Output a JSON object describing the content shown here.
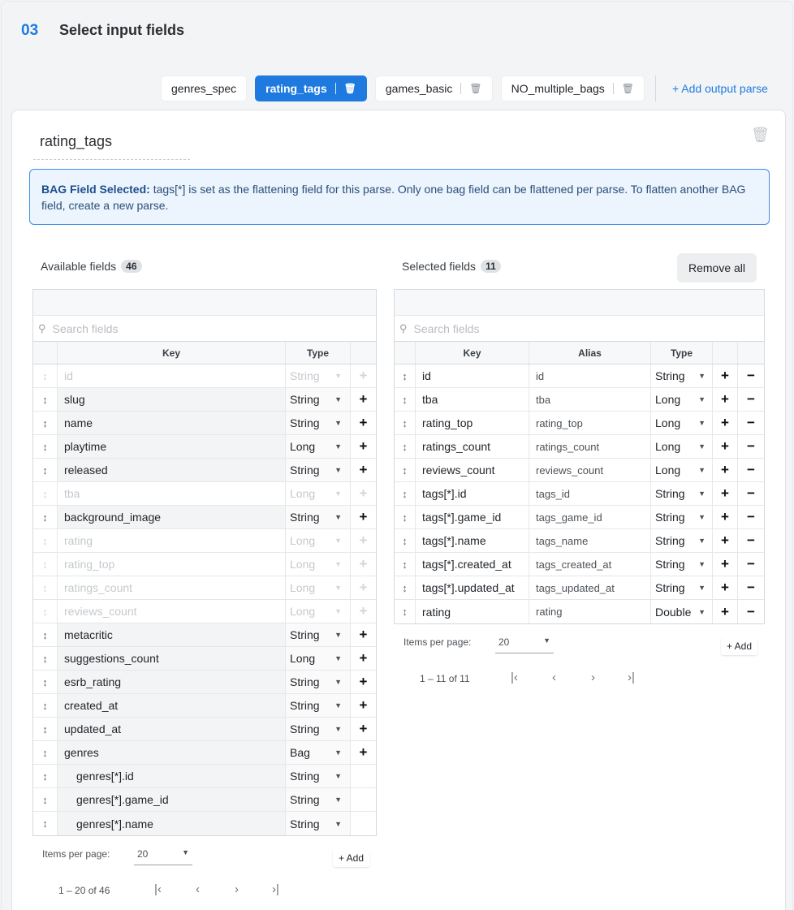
{
  "step": {
    "number": "03",
    "title": "Select input fields"
  },
  "tabs": [
    {
      "label": "genres_spec",
      "active": false,
      "deletable": false
    },
    {
      "label": "rating_tags",
      "active": true,
      "deletable": true
    },
    {
      "label": "games_basic",
      "active": false,
      "deletable": true
    },
    {
      "label": "NO_multiple_bags",
      "active": false,
      "deletable": true
    }
  ],
  "add_output_parse": "+ Add output parse",
  "parse": {
    "name": "rating_tags"
  },
  "banner": {
    "bold": "BAG Field Selected:",
    "text": " tags[*] is set as the flattening field for this parse. Only one bag field can be flattened per parse. To flatten another BAG field, create a new parse."
  },
  "available": {
    "label": "Available fields",
    "count": "46",
    "search_placeholder": "Search fields",
    "headers": {
      "key": "Key",
      "type": "Type"
    },
    "rows": [
      {
        "key": "id",
        "type": "String",
        "disabled": true
      },
      {
        "key": "slug",
        "type": "String"
      },
      {
        "key": "name",
        "type": "String"
      },
      {
        "key": "playtime",
        "type": "Long"
      },
      {
        "key": "released",
        "type": "String"
      },
      {
        "key": "tba",
        "type": "Long",
        "disabled": true
      },
      {
        "key": "background_image",
        "type": "String"
      },
      {
        "key": "rating",
        "type": "Long",
        "disabled": true
      },
      {
        "key": "rating_top",
        "type": "Long",
        "disabled": true
      },
      {
        "key": "ratings_count",
        "type": "Long",
        "disabled": true
      },
      {
        "key": "reviews_count",
        "type": "Long",
        "disabled": true
      },
      {
        "key": "metacritic",
        "type": "String"
      },
      {
        "key": "suggestions_count",
        "type": "Long"
      },
      {
        "key": "esrb_rating",
        "type": "String"
      },
      {
        "key": "created_at",
        "type": "String"
      },
      {
        "key": "updated_at",
        "type": "String"
      },
      {
        "key": "genres",
        "type": "Bag"
      },
      {
        "key": "genres[*].id",
        "type": "String",
        "child": true
      },
      {
        "key": "genres[*].game_id",
        "type": "String",
        "child": true
      },
      {
        "key": "genres[*].name",
        "type": "String",
        "child": true
      }
    ],
    "items_per_page_label": "Items per page:",
    "items_per_page": "20",
    "add_label": "+ Add",
    "range": "1 – 20 of 46"
  },
  "selected": {
    "label": "Selected fields",
    "count": "11",
    "remove_all": "Remove all",
    "search_placeholder": "Search fields",
    "headers": {
      "key": "Key",
      "alias": "Alias",
      "type": "Type"
    },
    "rows": [
      {
        "key": "id",
        "alias": "id",
        "type": "String"
      },
      {
        "key": "tba",
        "alias": "tba",
        "type": "Long"
      },
      {
        "key": "rating_top",
        "alias": "rating_top",
        "type": "Long"
      },
      {
        "key": "ratings_count",
        "alias": "ratings_count",
        "type": "Long"
      },
      {
        "key": "reviews_count",
        "alias": "reviews_count",
        "type": "Long"
      },
      {
        "key": "tags[*].id",
        "alias": "tags_id",
        "type": "String"
      },
      {
        "key": "tags[*].game_id",
        "alias": "tags_game_id",
        "type": "String"
      },
      {
        "key": "tags[*].name",
        "alias": "tags_name",
        "type": "String"
      },
      {
        "key": "tags[*].created_at",
        "alias": "tags_created_at",
        "type": "String"
      },
      {
        "key": "tags[*].updated_at",
        "alias": "tags_updated_at",
        "type": "String"
      },
      {
        "key": "rating",
        "alias": "rating",
        "type": "Double"
      }
    ],
    "items_per_page_label": "Items per page:",
    "items_per_page": "20",
    "add_label": "+ Add",
    "range": "1 – 11 of 11"
  },
  "icons": {
    "trash": "trash-icon",
    "drag": "drag-handle-icon",
    "plus": "plus-icon",
    "minus": "minus-icon",
    "caret": "caret-down-icon",
    "search": "search-icon",
    "first": "first-page-icon",
    "prev": "prev-page-icon",
    "next": "next-page-icon",
    "last": "last-page-icon"
  },
  "colors": {
    "accent": "#1f7ae0",
    "banner_bg": "#ecf4fd",
    "banner_border": "#3f8ee6"
  }
}
